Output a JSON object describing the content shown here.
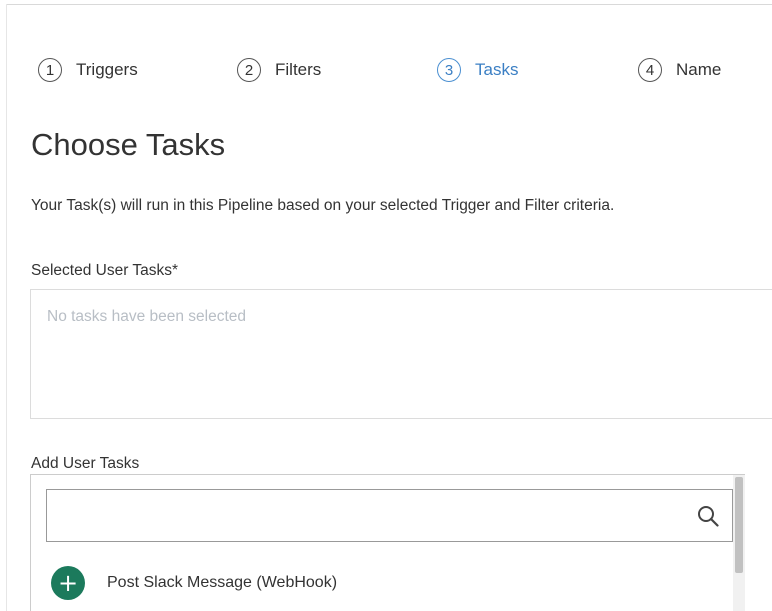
{
  "stepper": {
    "steps": [
      {
        "number": "1",
        "label": "Triggers",
        "active": false
      },
      {
        "number": "2",
        "label": "Filters",
        "active": false
      },
      {
        "number": "3",
        "label": "Tasks",
        "active": true
      },
      {
        "number": "4",
        "label": "Name",
        "active": false
      }
    ]
  },
  "page": {
    "title": "Choose Tasks",
    "description": "Your Task(s) will run in this Pipeline based on your selected Trigger and Filter criteria."
  },
  "selected_tasks": {
    "label": "Selected User Tasks*",
    "empty_text": "No tasks have been selected"
  },
  "add_tasks": {
    "label": "Add User Tasks",
    "search_value": "",
    "search_icon": "search-icon",
    "items": [
      {
        "label": "Post Slack Message (WebHook)",
        "icon": "plus-icon"
      }
    ]
  },
  "colors": {
    "active_step": "#3b7fc4",
    "add_icon_bg": "#1c7a5c",
    "placeholder_text": "#b8bec5"
  }
}
